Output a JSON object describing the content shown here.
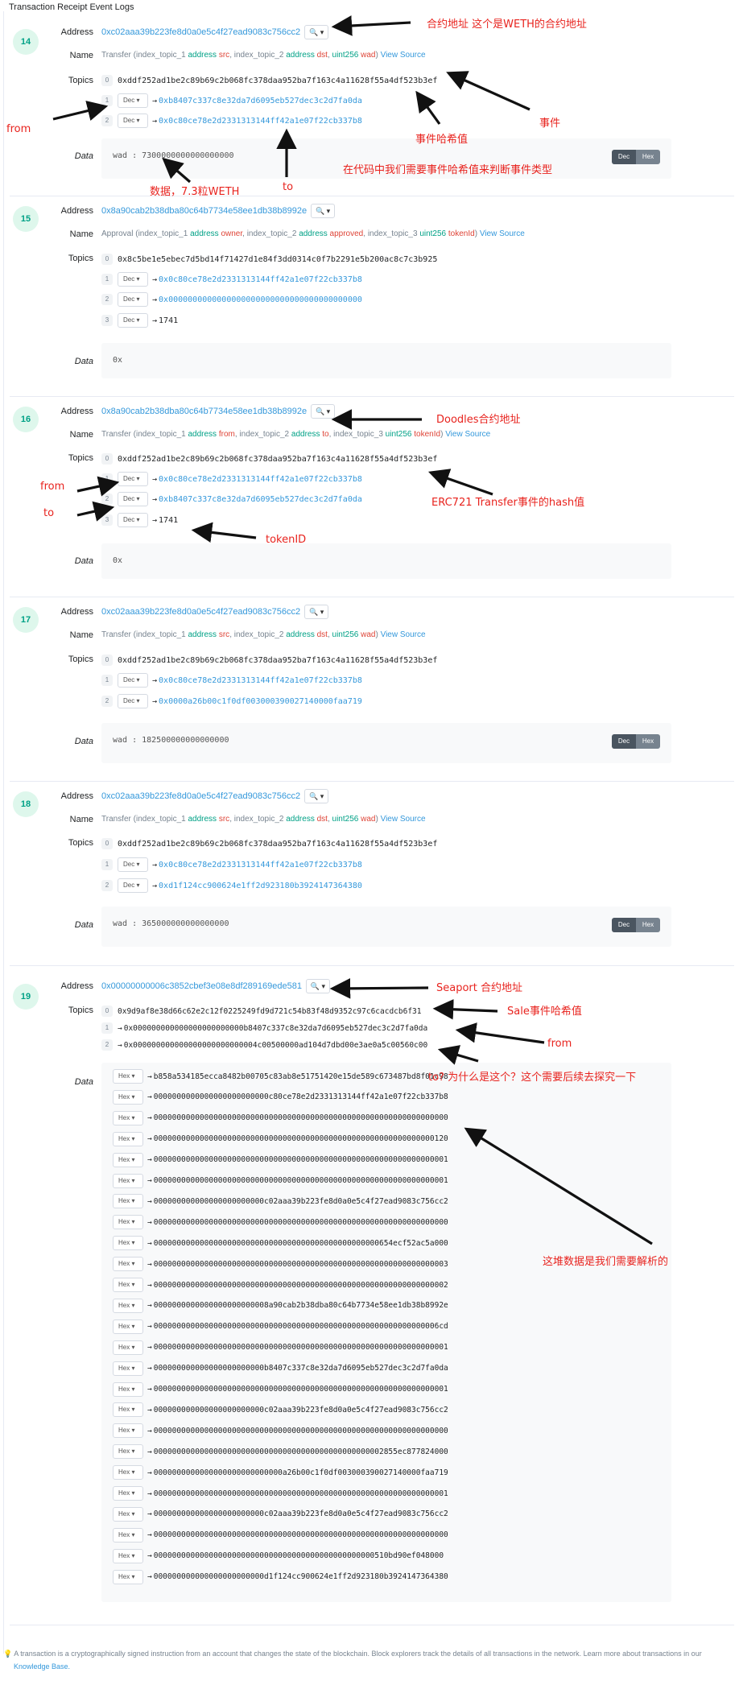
{
  "page_title": "Transaction Receipt Event Logs",
  "labels": {
    "address": "Address",
    "name": "Name",
    "topics": "Topics",
    "data": "Data"
  },
  "logs": [
    {
      "index": "14",
      "address": "0xc02aaa39b223fe8d0a0e5c4f27ead9083c756cc2",
      "name_sig": {
        "fn": "Transfer",
        "p1": "index_topic_1",
        "t1": "address",
        "n1": "src",
        "p2": "index_topic_2",
        "t2": "address",
        "n2": "dst",
        "t3": "uint256",
        "n3": "wad"
      },
      "topic0": "0xddf252ad1be2c89b69c2b068fc378daa952ba7f163c4a11628f55a4df523b3ef",
      "topics": [
        {
          "n": "1",
          "mode": "Dec",
          "value": "0xb8407c337c8e32da7d6095eb527dec3c2d7fa0da"
        },
        {
          "n": "2",
          "mode": "Dec",
          "value": "0x0c80ce78e2d2331313144ff42a1e07f22cb337b8"
        }
      ],
      "data_text": "wad : 7300000000000000000"
    },
    {
      "index": "15",
      "address": "0x8a90cab2b38dba80c64b7734e58ee1db38b8992e",
      "name_sig": {
        "fn": "Approval",
        "p1": "index_topic_1",
        "t1": "address",
        "n1": "owner",
        "p2": "index_topic_2",
        "t2": "address",
        "n2": "approved",
        "p3": "index_topic_3",
        "t3": "uint256",
        "n3": "tokenId"
      },
      "topic0": "0x8c5be1e5ebec7d5bd14f71427d1e84f3dd0314c0f7b2291e5b200ac8c7c3b925",
      "topics": [
        {
          "n": "1",
          "mode": "Dec",
          "value": "0x0c80ce78e2d2331313144ff42a1e07f22cb337b8"
        },
        {
          "n": "2",
          "mode": "Dec",
          "value": "0x0000000000000000000000000000000000000000"
        },
        {
          "n": "3",
          "mode": "Dec",
          "value": "1741"
        }
      ],
      "data_text": "0x"
    },
    {
      "index": "16",
      "address": "0x8a90cab2b38dba80c64b7734e58ee1db38b8992e",
      "name_sig": {
        "fn": "Transfer",
        "p1": "index_topic_1",
        "t1": "address",
        "n1": "from",
        "p2": "index_topic_2",
        "t2": "address",
        "n2": "to",
        "p3": "index_topic_3",
        "t3": "uint256",
        "n3": "tokenId"
      },
      "topic0": "0xddf252ad1be2c89b69c2b068fc378daa952ba7f163c4a11628f55a4df523b3ef",
      "topics": [
        {
          "n": "1",
          "mode": "Dec",
          "value": "0x0c80ce78e2d2331313144ff42a1e07f22cb337b8"
        },
        {
          "n": "2",
          "mode": "Dec",
          "value": "0xb8407c337c8e32da7d6095eb527dec3c2d7fa0da"
        },
        {
          "n": "3",
          "mode": "Dec",
          "value": "1741"
        }
      ],
      "data_text": "0x"
    },
    {
      "index": "17",
      "address": "0xc02aaa39b223fe8d0a0e5c4f27ead9083c756cc2",
      "name_sig": {
        "fn": "Transfer",
        "p1": "index_topic_1",
        "t1": "address",
        "n1": "src",
        "p2": "index_topic_2",
        "t2": "address",
        "n2": "dst",
        "t3": "uint256",
        "n3": "wad"
      },
      "topic0": "0xddf252ad1be2c89b69c2b068fc378daa952ba7f163c4a11628f55a4df523b3ef",
      "topics": [
        {
          "n": "1",
          "mode": "Dec",
          "value": "0x0c80ce78e2d2331313144ff42a1e07f22cb337b8"
        },
        {
          "n": "2",
          "mode": "Dec",
          "value": "0x0000a26b00c1f0df003000390027140000faa719"
        }
      ],
      "data_text": "wad : 182500000000000000"
    },
    {
      "index": "18",
      "address": "0xc02aaa39b223fe8d0a0e5c4f27ead9083c756cc2",
      "name_sig": {
        "fn": "Transfer",
        "p1": "index_topic_1",
        "t1": "address",
        "n1": "src",
        "p2": "index_topic_2",
        "t2": "address",
        "n2": "dst",
        "t3": "uint256",
        "n3": "wad"
      },
      "topic0": "0xddf252ad1be2c89b69c2b068fc378daa952ba7f163c4a11628f55a4df523b3ef",
      "topics": [
        {
          "n": "1",
          "mode": "Dec",
          "value": "0x0c80ce78e2d2331313144ff42a1e07f22cb337b8"
        },
        {
          "n": "2",
          "mode": "Dec",
          "value": "0xd1f124cc900624e1ff2d923180b3924147364380"
        }
      ],
      "data_text": "wad : 365000000000000000"
    },
    {
      "index": "19",
      "address": "0x00000000006c3852cbef3e08e8df289169ede581",
      "topic0": "0x9d9af8e38d66c62e2c12f0225249fd9d721c54b83f48d9352c97c6cacdcb6f31",
      "topics": [
        {
          "n": "1",
          "value": "0x000000000000000000000000b8407c337c8e32da7d6095eb527dec3c2d7fa0da"
        },
        {
          "n": "2",
          "value": "0x000000000000000000000000004c00500000ad104d7dbd00e3ae0a5c00560c00"
        }
      ],
      "data_rows": [
        "b858a534185ecca8482b00705c83ab8e51751420e15de589c673487bd8f01c98",
        "0000000000000000000000000c80ce78e2d2331313144ff42a1e07f22cb337b8",
        "0000000000000000000000000000000000000000000000000000000000000000",
        "0000000000000000000000000000000000000000000000000000000000000120",
        "0000000000000000000000000000000000000000000000000000000000000001",
        "0000000000000000000000000000000000000000000000000000000000000001",
        "000000000000000000000000c02aaa39b223fe8d0a0e5c4f27ead9083c756cc2",
        "0000000000000000000000000000000000000000000000000000000000000000",
        "0000000000000000000000000000000000000000000000000654ecf52ac5a000",
        "0000000000000000000000000000000000000000000000000000000000000003",
        "0000000000000000000000000000000000000000000000000000000000000002",
        "0000000000000000000000008a90cab2b38dba80c64b7734e58ee1db38b8992e",
        "00000000000000000000000000000000000000000000000000000000000006cd",
        "0000000000000000000000000000000000000000000000000000000000000001",
        "000000000000000000000000b8407c337c8e32da7d6095eb527dec3c2d7fa0da",
        "0000000000000000000000000000000000000000000000000000000000000001",
        "000000000000000000000000c02aaa39b223fe8d0a0e5c4f27ead9083c756cc2",
        "0000000000000000000000000000000000000000000000000000000000000000",
        "00000000000000000000000000000000000000000000000002855ec877824000",
        "0000000000000000000000000000a26b00c1f0df003000390027140000faa719",
        "0000000000000000000000000000000000000000000000000000000000000001",
        "000000000000000000000000c02aaa39b223fe8d0a0e5c4f27ead9083c756cc2",
        "0000000000000000000000000000000000000000000000000000000000000000",
        "000000000000000000000000000000000000000000000000510bd90ef048000",
        "000000000000000000000000d1f124cc900624e1ff2d923180b3924147364380"
      ]
    }
  ],
  "ui": {
    "dec": "Dec",
    "hex": "Hex",
    "view_source": "View Source",
    "arrow": "→",
    "search_glyph": "🔍 ▾",
    "caret": "▾"
  },
  "annotations": {
    "weth_addr": "合约地址 这个是WETH的合约地址",
    "from1": "from",
    "event": "事件",
    "event_hash": "事件哈希值",
    "need_hash": "在代码中我们需要事件哈希值来判断事件类型",
    "amount": "数据，7.3粒WETH",
    "to1": "to",
    "doodles": "Doodles合约地址",
    "from2": "from",
    "to2": "to",
    "erc721": "ERC721 Transfer事件的hash值",
    "tokenid": "tokenID",
    "seaport": "Seaport 合约地址",
    "sale": "Sale事件哈希值",
    "from3": "from",
    "to3": "to? 为什么是这个？这个需要后续去探究一下",
    "parse": "这堆数据是我们需要解析的"
  },
  "footer": {
    "text": "A transaction is a cryptographically signed instruction from an account that changes the state of the blockchain. Block explorers track the details of all transactions in the network. Learn more about transactions in our",
    "link": "Knowledge Base."
  }
}
